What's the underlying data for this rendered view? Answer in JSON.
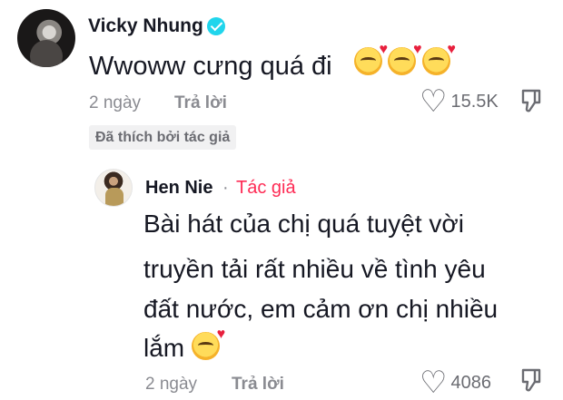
{
  "comment": {
    "username": "Vicky Nhung",
    "text": "Wwoww cưng quá đi",
    "emoji_count": 3,
    "emoji_name": "smiling-face-with-hearts-icon",
    "time": "2 ngày",
    "reply_label": "Trả lời",
    "likes": "15.5K",
    "liked_badge": "Đã thích bởi tác giả"
  },
  "reply": {
    "username": "Hen Nie",
    "separator": "·",
    "author_tag": "Tác giả",
    "lines": [
      "Bài hát của chị quá tuyệt vời",
      "truyền tải rất nhiều về tình yêu",
      "đất nước, em cảm ơn chị nhiều",
      "lắm"
    ],
    "time": "2 ngày",
    "reply_label": "Trả lời",
    "likes": "4086"
  },
  "colors": {
    "author_tag": "#fe2c55",
    "verified": "#20d5ec",
    "meta": "#8a8b91"
  }
}
